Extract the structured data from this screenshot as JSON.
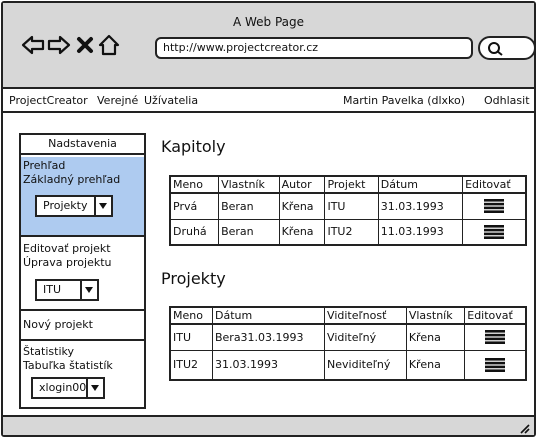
{
  "window": {
    "title": "A Web Page"
  },
  "browser": {
    "url": "http://www.projectcreator.cz",
    "search_value": ""
  },
  "menu": {
    "brand": "ProjectCreator",
    "items": [
      "Verejné",
      "Užívatelia"
    ],
    "user": "Martin Pavelka (dlxko)",
    "logout": "Odhlasit"
  },
  "sidebar": {
    "title": "Nadstavenia",
    "overview": {
      "line1": "Prehľad",
      "line2": "Základný prehľad",
      "select": "Projekty"
    },
    "edit": {
      "line1": "Editovať projekt",
      "line2": "Úprava projektu",
      "select": "ITU"
    },
    "new_project": "Nový projekt",
    "stats": {
      "line1": "Štatistiky",
      "line2": "Tabuľka štatistík",
      "select": "xlogin00"
    }
  },
  "chapters": {
    "title": "Kapitoly",
    "columns": [
      "Meno",
      "Vlastník",
      "Autor",
      "Projekt",
      "Dátum",
      "Editovať"
    ],
    "rows": [
      [
        "Prvá",
        "Beran",
        "Křena",
        "ITU",
        "31.03.1993"
      ],
      [
        "Druhá",
        "Beran",
        "Křena",
        "ITU2",
        "11.03.1993"
      ]
    ]
  },
  "projects": {
    "title": "Projekty",
    "columns": [
      "Meno",
      "Dátum",
      "Viditeľnosť",
      "Vlastník",
      "Editovať"
    ],
    "rows": [
      [
        "ITU",
        "Bera31.03.1993",
        "Viditeľný",
        "Křena"
      ],
      [
        "ITU2",
        "31.03.1993",
        "Neviditeľný",
        "Křena"
      ]
    ]
  },
  "colors": {
    "chrome": "#d7d7d7",
    "active_section": "#aecbf0",
    "border": "#222222"
  }
}
